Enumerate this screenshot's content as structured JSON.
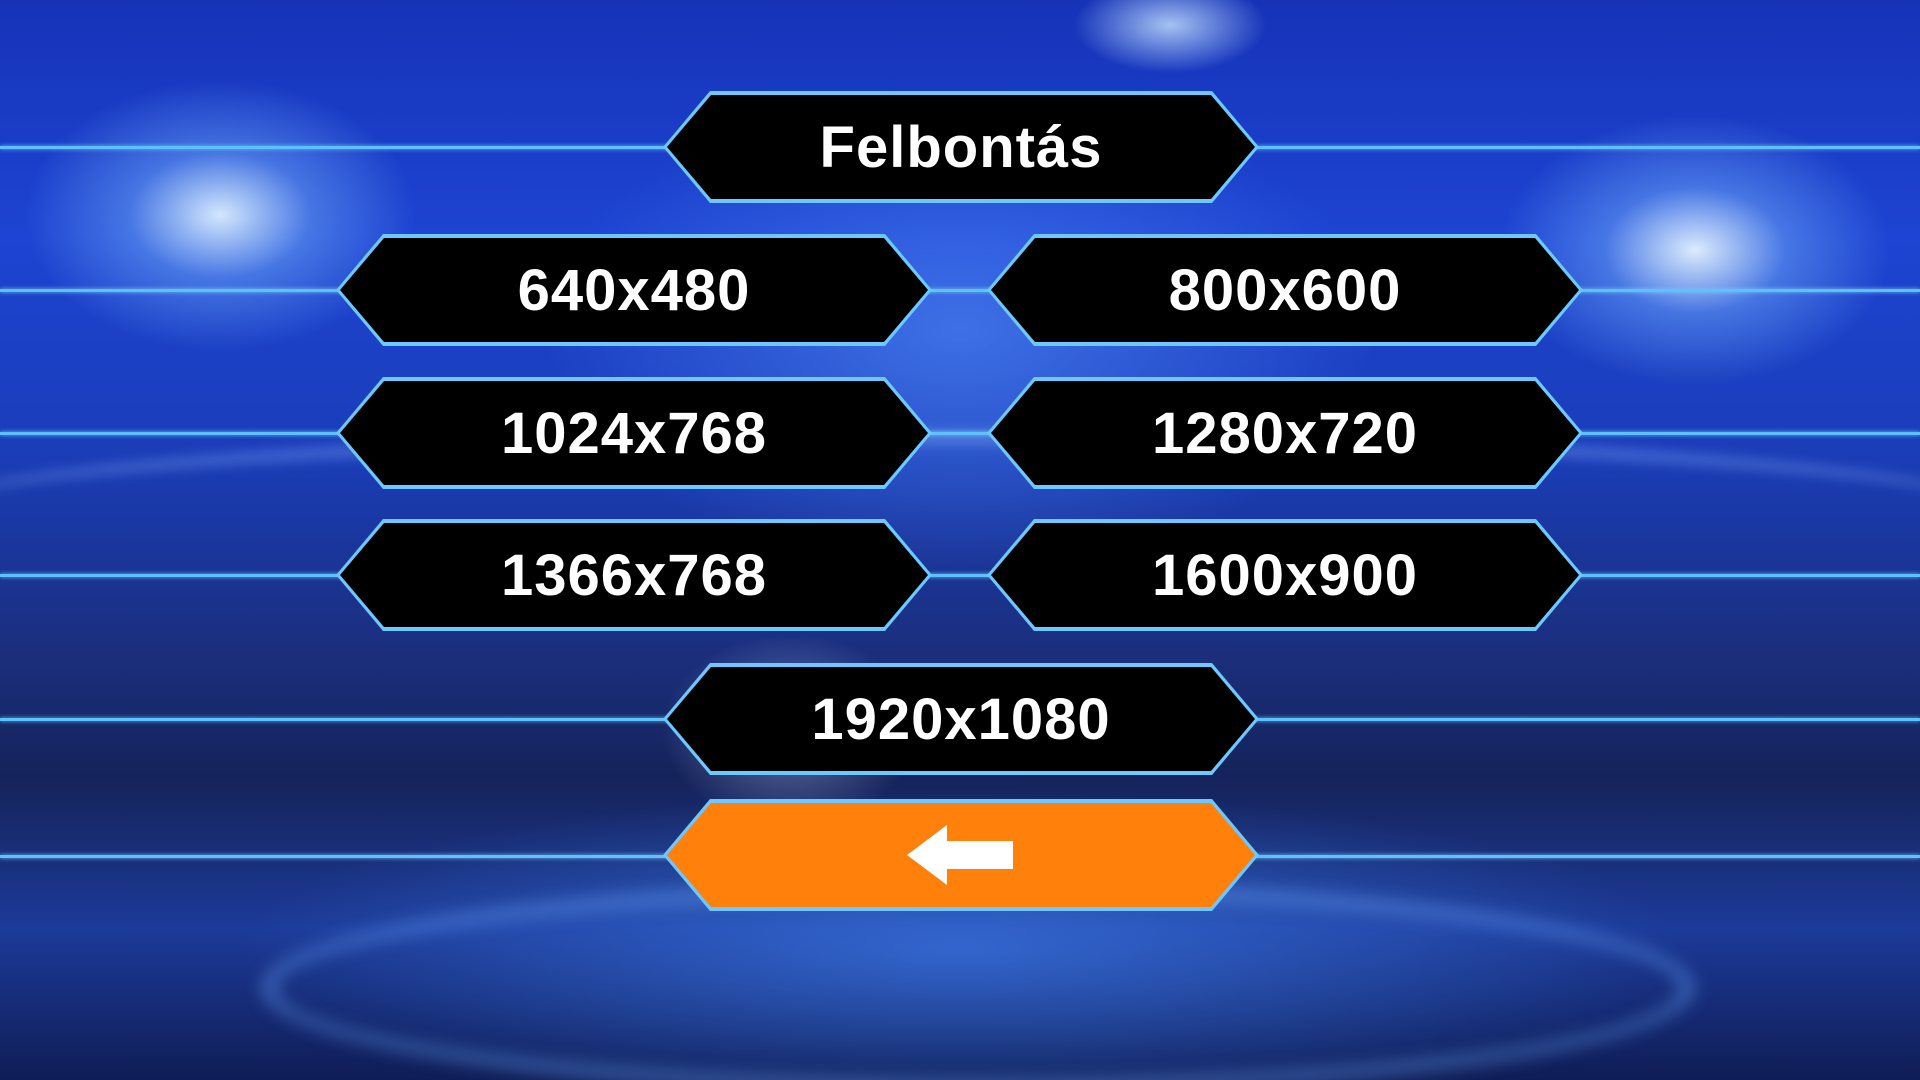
{
  "menu": {
    "title": "Felbontás",
    "resolutions": [
      "640x480",
      "800x600",
      "1024x768",
      "1280x720",
      "1366x768",
      "1600x900",
      "1920x1080"
    ],
    "back_icon": "arrow-left-icon"
  },
  "colors": {
    "button_fill": "#000000",
    "button_border": "#6cc8ff",
    "line": "#5cc2ff",
    "back_fill": "#ff800a",
    "text": "#ffffff"
  }
}
